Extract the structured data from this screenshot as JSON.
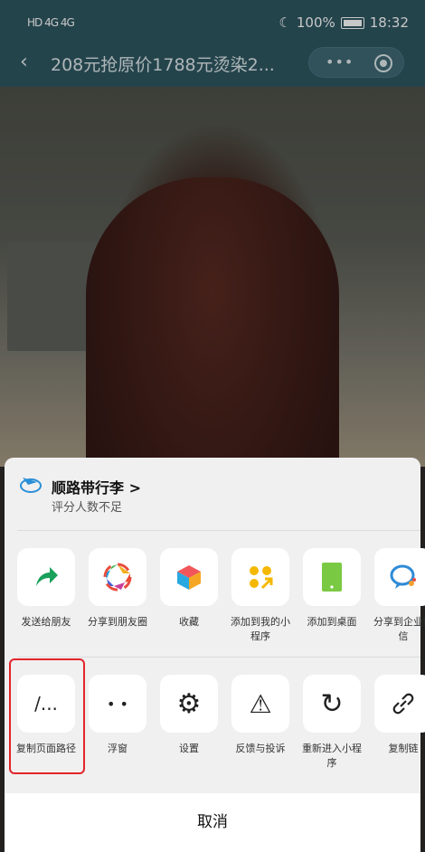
{
  "status_bar": {
    "left_indicators": "HD 4G 4G",
    "battery": "100%",
    "time": "18:32"
  },
  "navbar": {
    "title": "208元抢原价1788元烫染2...",
    "more_icon": "more-dots-icon",
    "close_icon": "record-close-icon"
  },
  "sheet": {
    "app": {
      "name": "顺路带行李 >",
      "rating": "评分人数不足"
    },
    "row1": [
      {
        "label": "发送给朋友",
        "icon": "share-arrow-icon",
        "color": "#19a05a"
      },
      {
        "label": "分享到朋友圈",
        "icon": "moments-aperture-icon",
        "color": "#f2b01e"
      },
      {
        "label": "收藏",
        "icon": "favorite-cube-icon",
        "color": "#f5a623"
      },
      {
        "label": "添加到我的小程序",
        "icon": "mini-program-dots-icon",
        "color": "#f5b800"
      },
      {
        "label": "添加到桌面",
        "icon": "phone-screen-icon",
        "color": "#7ac943"
      },
      {
        "label": "分享到企业微信",
        "icon": "wecom-chat-icon",
        "color": "#2f8bd6"
      }
    ],
    "row2": [
      {
        "label": "复制页面路径",
        "glyph": "/..."
      },
      {
        "label": "浮窗",
        "glyph": "• •"
      },
      {
        "label": "设置",
        "glyph": "⚙"
      },
      {
        "label": "反馈与投诉",
        "glyph": "⚠"
      },
      {
        "label": "重新进入小程序",
        "glyph": "↻"
      },
      {
        "label": "复制链",
        "glyph": "🔗"
      }
    ],
    "cancel": "取消"
  },
  "highlight_color": "#e3242b"
}
